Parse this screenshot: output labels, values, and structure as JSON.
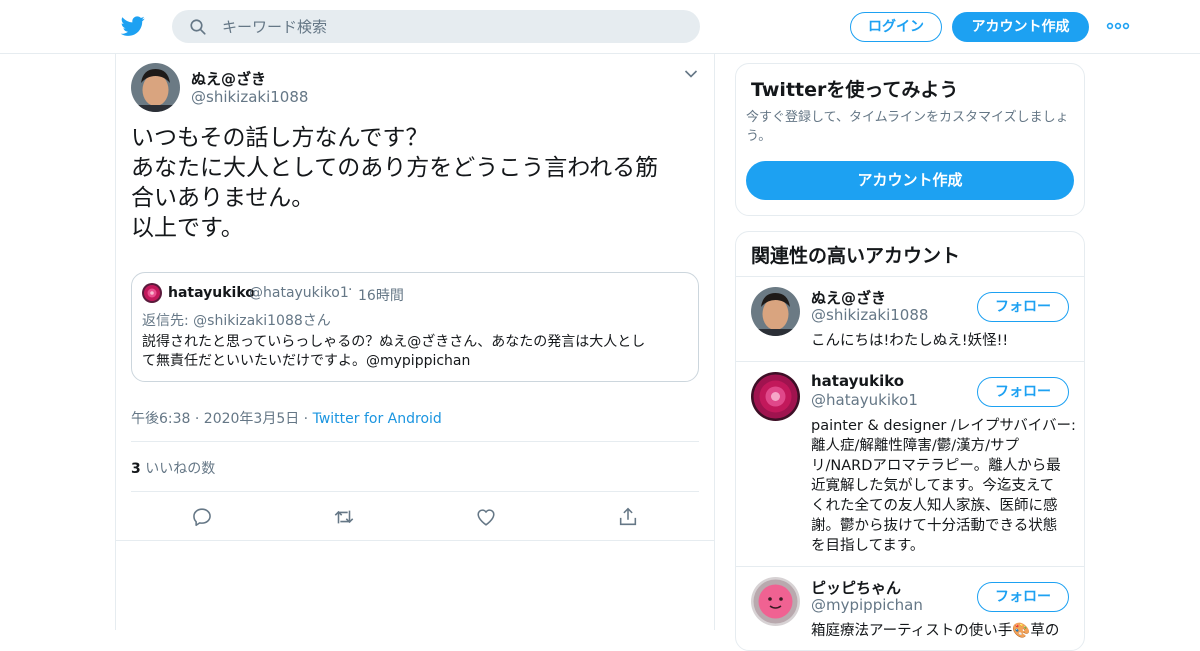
{
  "header": {
    "search_placeholder": "キーワード検索",
    "login_label": "ログイン",
    "signup_label": "アカウント作成",
    "brand_color": "#1da1f2"
  },
  "tweet": {
    "author_name": "ぬえ@ざき",
    "author_handle": "@shikizaki1088",
    "text_lines": [
      "いつもその話し方なんです？",
      "あなたに大人としてのあり方をどうこう言われる筋",
      "合いありません。",
      "以上です。"
    ],
    "quote": {
      "author_name": "hatayukiko",
      "author_handle": "@hatayukiko1",
      "separator": "·",
      "time": "16時間",
      "reply_to": "返信先: @shikizaki1088さん",
      "text_lines": [
        "説得されたと思っていらっしゃるの？ぬえ@ざきさん、あなたの発言は大人とし",
        "て無責任だといいたいだけですよ。@mypippichan"
      ]
    },
    "timestamp": "午後6:38 · 2020年3月5日 · ",
    "source": "Twitter for Android",
    "likes_count": "3",
    "likes_label": "いいねの数",
    "actions": [
      "reply-icon",
      "retweet-icon",
      "like-icon",
      "share-icon"
    ]
  },
  "sidebar": {
    "try_card": {
      "title": "Twitterを使ってみよう",
      "description_lines": [
        "今すぐ登録して、タイムラインをカスタマイズしましょ",
        "う。"
      ],
      "button_label": "アカウント作成"
    },
    "related": {
      "title": "関連性の高いアカウント",
      "follow_label": "フォロー",
      "accounts": [
        {
          "name": "ぬえ@ざき",
          "handle": "@shikizaki1088",
          "bio_lines": [
            "こんにちは!わたしぬえ!妖怪!!"
          ]
        },
        {
          "name": "hatayukiko",
          "handle": "@hatayukiko1",
          "bio_lines": [
            "painter & designer /レイプサバイバー:",
            "離人症/解離性障害/鬱/漢方/サプ",
            "リ/NARDアロマテラピー。離人から最",
            "近寛解した気がしてます。今迄支えて",
            "くれた全ての友人知人家族、医師に感",
            "謝。鬱から抜けて十分活動できる状態",
            "を目指してます。"
          ]
        },
        {
          "name": "ピッピちゃん",
          "handle": "@mypippichan",
          "bio_lines": [
            "箱庭療法アーティストの使い手🎨草の"
          ]
        }
      ]
    }
  }
}
